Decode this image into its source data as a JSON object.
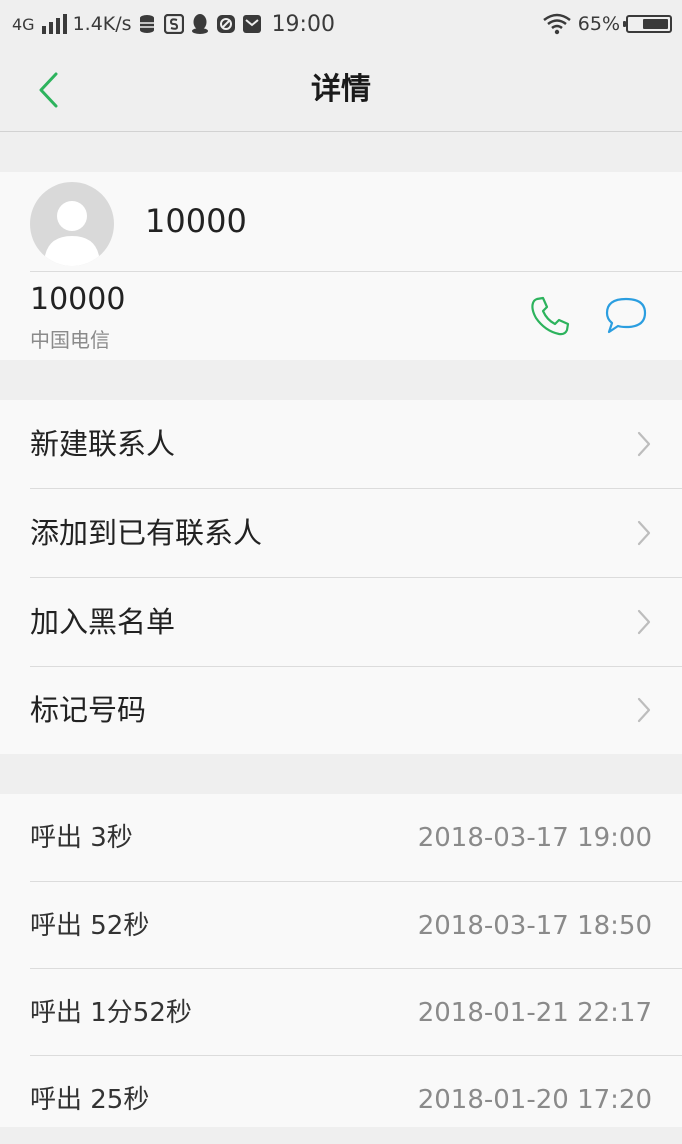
{
  "status_bar": {
    "network_type": "4G",
    "speed": "1.4K/s",
    "time": "19:00",
    "battery_percent": "65%",
    "battery_level": 0.65
  },
  "header": {
    "title": "详情"
  },
  "contact": {
    "name": "10000",
    "number": "10000",
    "carrier": "中国电信"
  },
  "actions": [
    {
      "label": "新建联系人"
    },
    {
      "label": "添加到已有联系人"
    },
    {
      "label": "加入黑名单"
    },
    {
      "label": "标记号码"
    }
  ],
  "call_history": [
    {
      "type": "呼出 3秒",
      "time": "2018-03-17 19:00"
    },
    {
      "type": "呼出 52秒",
      "time": "2018-03-17 18:50"
    },
    {
      "type": "呼出 1分52秒",
      "time": "2018-01-21 22:17"
    },
    {
      "type": "呼出 25秒",
      "time": "2018-01-20 17:20"
    }
  ],
  "colors": {
    "accent_green": "#2db35d",
    "message_blue": "#2b9ee0",
    "background": "#efefef",
    "card": "#f9f9f9"
  },
  "icons": {
    "back": "chevron-left-icon",
    "call": "phone-icon",
    "message": "chat-bubble-icon",
    "row": "chevron-right-icon"
  }
}
